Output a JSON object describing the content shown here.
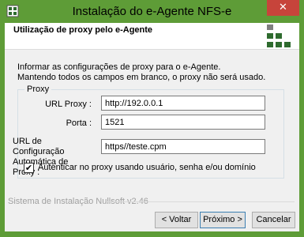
{
  "window": {
    "title": "Instalação do e-Agente NFS-e",
    "close_glyph": "✕",
    "accent_color": "#5e9c37",
    "close_color": "#c7443b"
  },
  "header": {
    "title": "Utilização de proxy pelo e-Agente",
    "logo_icon": "nfse-logo-icon"
  },
  "intro": {
    "line1": "Informar as configurações de proxy para o e-Agente.",
    "line2": "Mantendo todos os campos em branco, o proxy não será usado."
  },
  "proxy_group": {
    "label": "Proxy",
    "url_label": "URL Proxy :",
    "url_value": "http://192.0.0.1",
    "port_label": "Porta :",
    "port_value": "1521",
    "auto_label_line1": "URL de Configuração",
    "auto_label_line2": "Automática de Proxy :",
    "auto_value": "https//teste.cpm",
    "auth_label": "Autenticar no proxy usando usuário, senha e/ou domínio",
    "auth_checked": true,
    "check_glyph": "✔"
  },
  "footer": {
    "branding": "Sistema de Instalação Nullsoft v2.46",
    "back_label": "< Voltar",
    "next_label": "Próximo >",
    "cancel_label": "Cancelar"
  }
}
